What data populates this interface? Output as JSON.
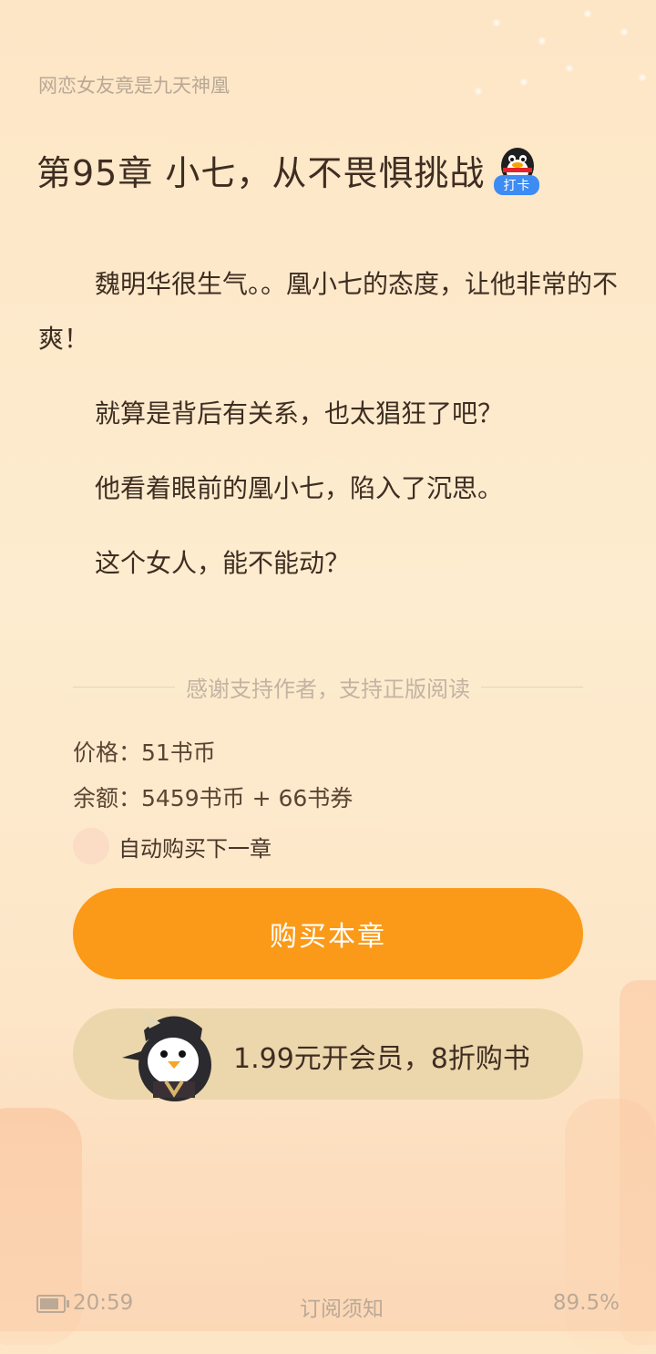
{
  "book": {
    "title": "网恋女友竟是九天神凰"
  },
  "chapter": {
    "title": "第95章 小七，从不畏惧挑战",
    "badge_label": "打卡",
    "paragraphs": [
      "魏明华很生气。。凰小七的态度，让他非常的不爽！",
      "就算是背后有关系，也太猖狂了吧？",
      "他看着眼前的凰小七，陷入了沉思。",
      "这个女人，能不能动？"
    ]
  },
  "purchase": {
    "divider_text": "感谢支持作者，支持正版阅读",
    "price": "价格：51书币",
    "balance": "余额：5459书币 + 66书券",
    "auto_buy_label": "自动购买下一章",
    "buy_button": "购买本章",
    "member_button": "1.99元开会员，8折购书"
  },
  "status": {
    "time": "20:59",
    "notice": "订阅须知",
    "progress": "89.5%",
    "battery_level": 0.85
  },
  "colors": {
    "accent": "#fb9a18",
    "member_bg": "#ecd7ad",
    "page_bg": "#fde9cb"
  }
}
